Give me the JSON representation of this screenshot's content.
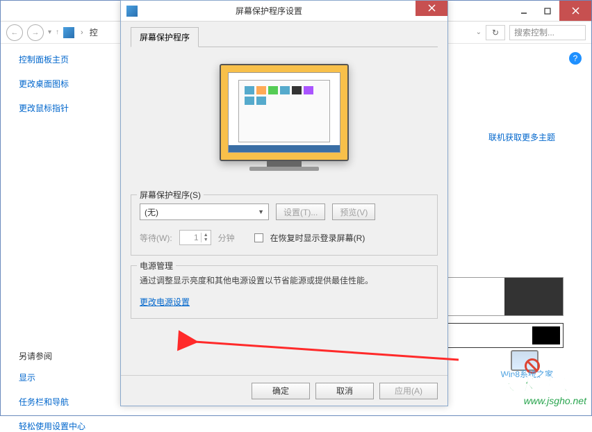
{
  "parent": {
    "breadcrumb": "控",
    "search_placeholder": "搜索控制...",
    "sidebar": {
      "home": "控制面板主页",
      "links": [
        "更改桌面图标",
        "更改鼠标指针"
      ],
      "see_also_label": "另请参阅",
      "see_also": [
        "显示",
        "任务栏和导航",
        "轻松使用设置中心"
      ]
    },
    "theme_link": "联机获取更多主题",
    "w8_mark": "Win8系统之家"
  },
  "dialog": {
    "title": "屏幕保护程序设置",
    "tab": "屏幕保护程序",
    "ss_group_label": "屏幕保护程序(S)",
    "ss_selected": "(无)",
    "btn_settings": "设置(T)...",
    "btn_preview": "预览(V)",
    "wait_label": "等待(W):",
    "wait_value": "1",
    "wait_unit": "分钟",
    "resume_label": "在恢复时显示登录屏幕(R)",
    "power_group_label": "电源管理",
    "power_desc": "通过调整显示亮度和其他电源设置以节省能源或提供最佳性能。",
    "power_link": "更改电源设置",
    "btn_ok": "确定",
    "btn_cancel": "取消",
    "btn_apply": "应用(A)"
  },
  "watermark": {
    "line1": "技术员联盟",
    "line2": "www.jsgho.net"
  }
}
